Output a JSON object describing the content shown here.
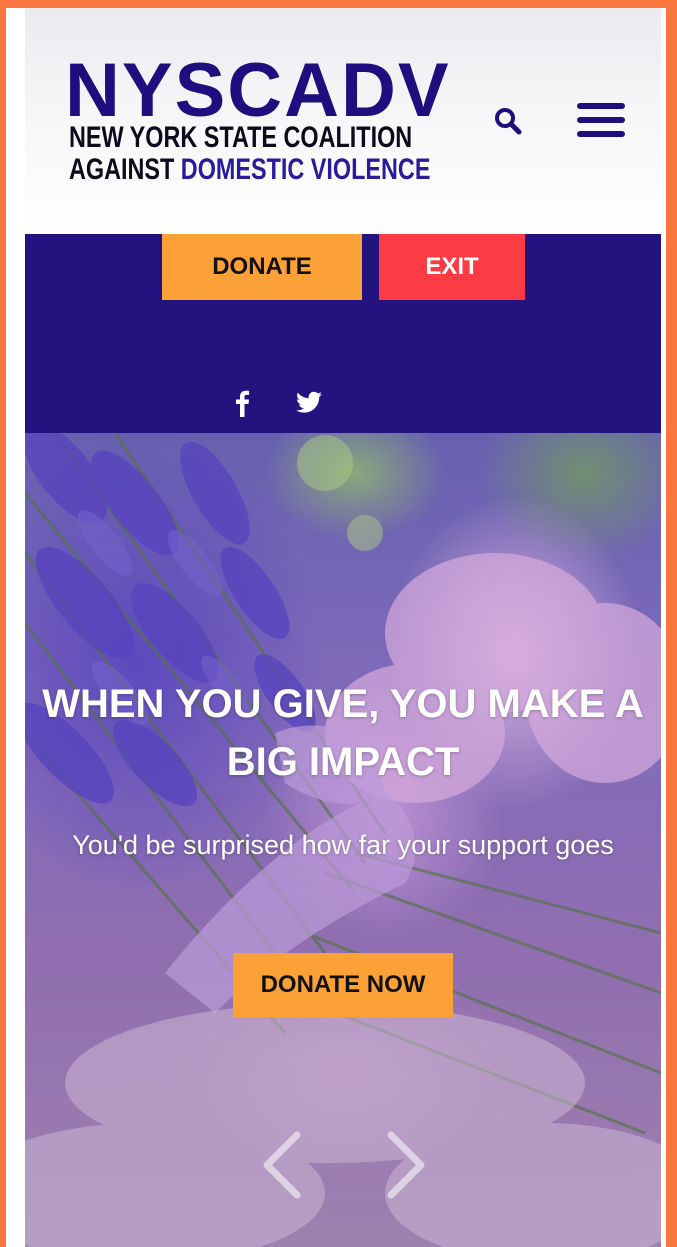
{
  "header": {
    "logo_main": "NYSCADV",
    "logo_line1": "NEW YORK STATE COALITION",
    "logo_line2_a": "AGAINST ",
    "logo_line2_b": "DOMESTIC VIOLENCE"
  },
  "icons": {
    "search": "search-icon",
    "menu": "hamburger-menu-icon",
    "facebook": "facebook-icon",
    "twitter": "twitter-icon",
    "prev": "chevron-left-icon",
    "next": "chevron-right-icon"
  },
  "topbar": {
    "donate_label": "DONATE",
    "exit_label": "EXIT"
  },
  "hero": {
    "title": "WHEN YOU GIVE, YOU MAKE A BIG IMPACT",
    "subtitle": "You'd be surprised how far your support goes",
    "button_label": "DONATE NOW"
  },
  "colors": {
    "page_border": "#fa7840",
    "brand_purple": "#22137f",
    "donate_orange": "#fba138",
    "exit_red": "#fc3b44"
  }
}
